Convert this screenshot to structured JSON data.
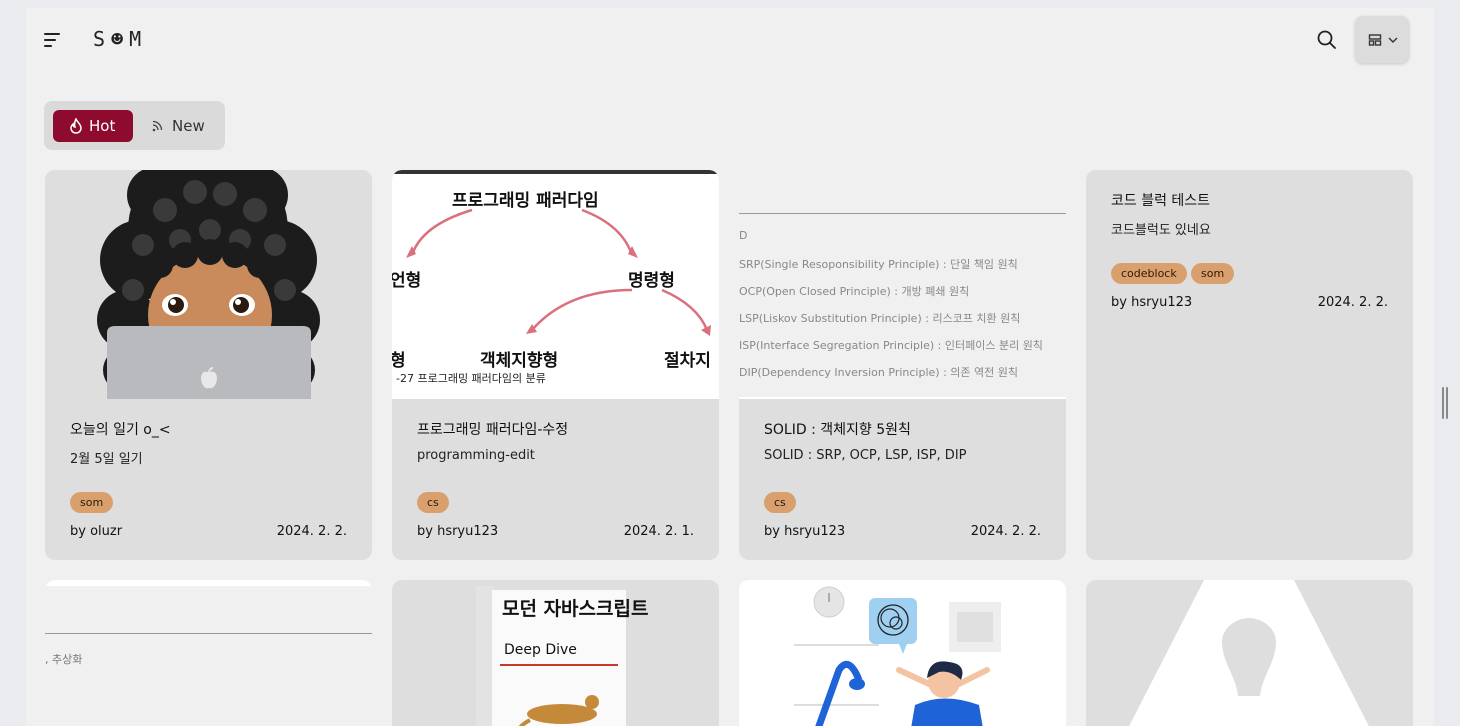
{
  "header": {
    "logo": "S☻M"
  },
  "tabs": [
    {
      "label": "Hot",
      "active": true
    },
    {
      "label": "New",
      "active": false
    }
  ],
  "cards": [
    {
      "title": "오늘의 일기 o_<",
      "subtitle": "2월 5일 일기",
      "tags": [
        "som"
      ],
      "author": "by oluzr",
      "date": "2024. 2. 2."
    },
    {
      "title": "프로그래밍 패러다임-수정",
      "subtitle": "programming-edit",
      "tags": [
        "cs"
      ],
      "author": "by hsryu123",
      "date": "2024. 2. 1.",
      "thumb": {
        "heading": "프로그래밍 패러다임",
        "left": "언형",
        "right": "명령형",
        "bottom_mid": "객체지향형",
        "bottom_right": "절차지",
        "bottom_left": "형",
        "caption": "-27 프로그래밍 패러다임의 분류"
      }
    },
    {
      "title": "SOLID : 객체지향 5원칙",
      "subtitle": "SOLID : SRP, OCP, LSP, ISP, DIP",
      "tags": [
        "cs"
      ],
      "author": "by hsryu123",
      "date": "2024. 2. 2.",
      "thumb": {
        "lines": [
          "D",
          "SRP(Single Resoponsibility Principle) : 단일 책임 원칙",
          "OCP(Open Closed Principle) : 개방 폐쇄 원칙",
          "LSP(Liskov Substitution Principle) : 리스코프 치환 원칙",
          "ISP(Interface Segregation Principle) : 인터페이스 분리 원칙",
          "DIP(Dependency Inversion Principle) : 의존 역전 원칙"
        ]
      }
    },
    {
      "title": "코드 블럭 테스트",
      "subtitle": "코드블럭도 있네요",
      "tags": [
        "codeblock",
        "som"
      ],
      "author": "by hsryu123",
      "date": "2024. 2. 2."
    }
  ],
  "row2": {
    "card1_text": ", 추상화",
    "book_title": "모던 자바스크립트",
    "book_subtitle": "Deep Dive"
  },
  "colors": {
    "accent": "#8e0b2f",
    "tag": "#d9a06d",
    "card_bg": "#dedede"
  }
}
